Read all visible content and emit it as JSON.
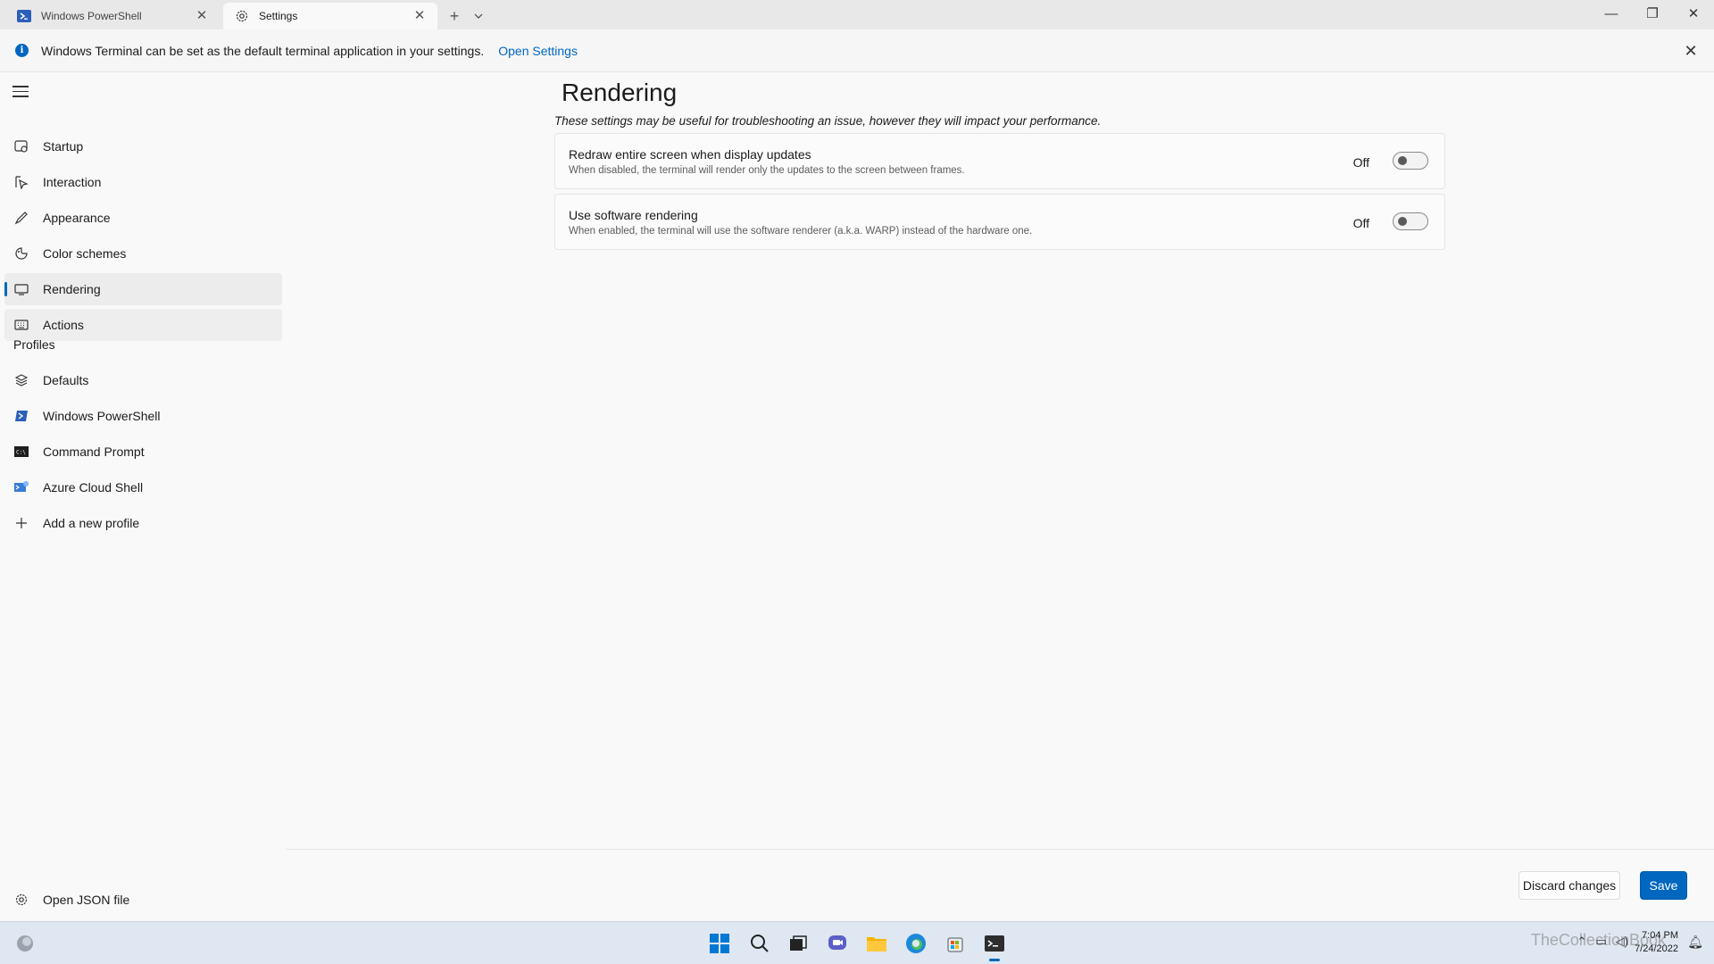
{
  "tabs": [
    {
      "label": "Windows PowerShell",
      "icon": "powershell-icon"
    },
    {
      "label": "Settings",
      "icon": "gear-icon"
    }
  ],
  "window_controls": {
    "minimize": "—",
    "restore": "❐",
    "close": "✕"
  },
  "infobar": {
    "message": "Windows Terminal can be set as the default terminal application in your settings.",
    "link": "Open Settings"
  },
  "sidebar": {
    "items": [
      {
        "label": "Startup",
        "icon": "startup-icon"
      },
      {
        "label": "Interaction",
        "icon": "interaction-icon"
      },
      {
        "label": "Appearance",
        "icon": "brush-icon"
      },
      {
        "label": "Color schemes",
        "icon": "color-schemes-icon"
      },
      {
        "label": "Rendering",
        "icon": "monitor-icon"
      },
      {
        "label": "Actions",
        "icon": "keyboard-icon"
      }
    ],
    "profiles_header": "Profiles",
    "profiles": [
      {
        "label": "Defaults",
        "icon": "layers-icon"
      },
      {
        "label": "Windows PowerShell",
        "icon": "powershell-icon"
      },
      {
        "label": "Command Prompt",
        "icon": "cmd-icon"
      },
      {
        "label": "Azure Cloud Shell",
        "icon": "azure-icon"
      },
      {
        "label": "Add a new profile",
        "icon": "plus-icon"
      }
    ],
    "footer": {
      "label": "Open JSON file",
      "icon": "gear-icon"
    }
  },
  "main": {
    "title": "Rendering",
    "subtitle": "These settings may be useful for troubleshooting an issue, however they will impact your performance.",
    "settings": [
      {
        "title": "Redraw entire screen when display updates",
        "description": "When disabled, the terminal will render only the updates to the screen between frames.",
        "state": "Off"
      },
      {
        "title": "Use software rendering",
        "description": "When enabled, the terminal will use the software renderer (a.k.a. WARP) instead of the hardware one.",
        "state": "Off"
      }
    ]
  },
  "footer_buttons": {
    "discard": "Discard changes",
    "save": "Save"
  },
  "taskbar": {
    "clock_time": "7:04 PM",
    "clock_date": "7/24/2022",
    "watermark": "TheCollectionBook"
  },
  "colors": {
    "accent": "#0067c0",
    "background": "#f9f9f9"
  }
}
